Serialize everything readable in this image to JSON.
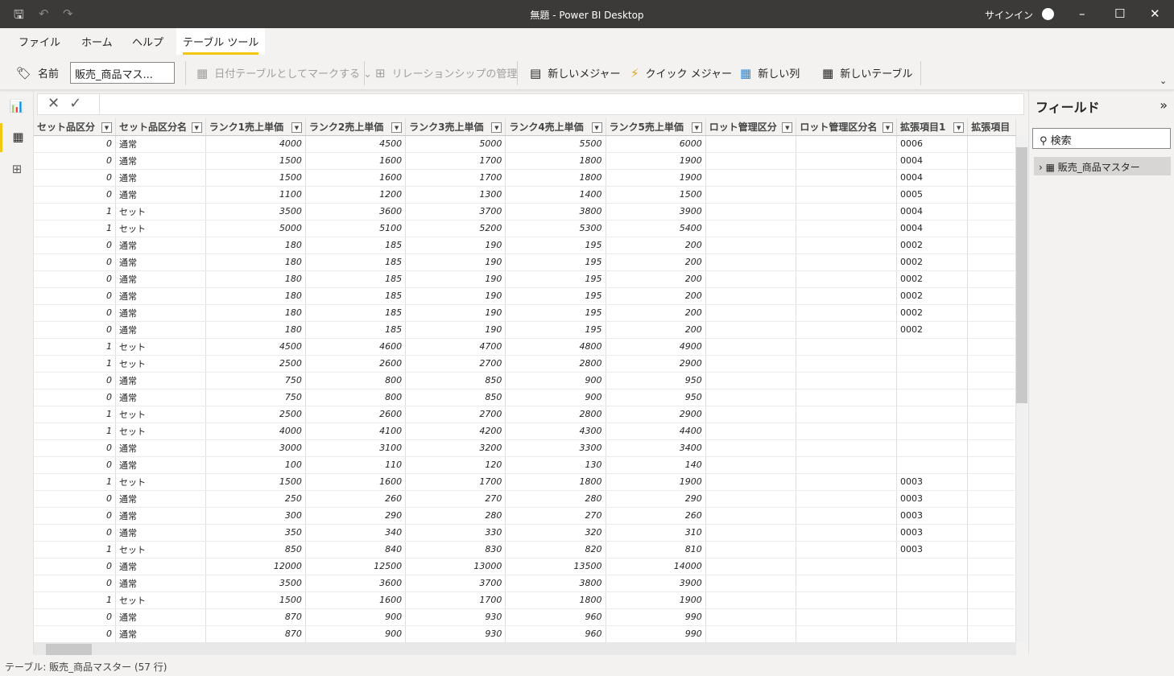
{
  "window": {
    "title": "無題 - Power BI Desktop",
    "signin": "サインイン"
  },
  "menu": {
    "items": [
      "ファイル",
      "ホーム",
      "ヘルプ",
      "テーブル ツール"
    ],
    "active": "テーブル ツール"
  },
  "ribbon": {
    "name_label": "名前",
    "name_value": "販売_商品マス...",
    "mark_date": "日付テーブルとしてマークする",
    "relations": "リレーションシップの管理",
    "new_measure": "新しいメジャー",
    "quick_measure": "クイック メジャー",
    "new_column": "新しい列",
    "new_table": "新しいテーブル"
  },
  "columns": [
    "セット品区分",
    "セット品区分名",
    "ランク1売上単価",
    "ランク2売上単価",
    "ランク3売上単価",
    "ランク4売上単価",
    "ランク5売上単価",
    "ロット管理区分",
    "ロット管理区分名",
    "拡張項目1",
    "拡張項目"
  ],
  "rows": [
    [
      "0",
      "通常",
      "4000",
      "4500",
      "5000",
      "5500",
      "6000",
      "",
      "",
      "0006"
    ],
    [
      "0",
      "通常",
      "1500",
      "1600",
      "1700",
      "1800",
      "1900",
      "",
      "",
      "0004"
    ],
    [
      "0",
      "通常",
      "1500",
      "1600",
      "1700",
      "1800",
      "1900",
      "",
      "",
      "0004"
    ],
    [
      "0",
      "通常",
      "1100",
      "1200",
      "1300",
      "1400",
      "1500",
      "",
      "",
      "0005"
    ],
    [
      "1",
      "セット",
      "3500",
      "3600",
      "3700",
      "3800",
      "3900",
      "",
      "",
      "0004"
    ],
    [
      "1",
      "セット",
      "5000",
      "5100",
      "5200",
      "5300",
      "5400",
      "",
      "",
      "0004"
    ],
    [
      "0",
      "通常",
      "180",
      "185",
      "190",
      "195",
      "200",
      "",
      "",
      "0002"
    ],
    [
      "0",
      "通常",
      "180",
      "185",
      "190",
      "195",
      "200",
      "",
      "",
      "0002"
    ],
    [
      "0",
      "通常",
      "180",
      "185",
      "190",
      "195",
      "200",
      "",
      "",
      "0002"
    ],
    [
      "0",
      "通常",
      "180",
      "185",
      "190",
      "195",
      "200",
      "",
      "",
      "0002"
    ],
    [
      "0",
      "通常",
      "180",
      "185",
      "190",
      "195",
      "200",
      "",
      "",
      "0002"
    ],
    [
      "0",
      "通常",
      "180",
      "185",
      "190",
      "195",
      "200",
      "",
      "",
      "0002"
    ],
    [
      "1",
      "セット",
      "4500",
      "4600",
      "4700",
      "4800",
      "4900",
      "",
      "",
      ""
    ],
    [
      "1",
      "セット",
      "2500",
      "2600",
      "2700",
      "2800",
      "2900",
      "",
      "",
      ""
    ],
    [
      "0",
      "通常",
      "750",
      "800",
      "850",
      "900",
      "950",
      "",
      "",
      ""
    ],
    [
      "0",
      "通常",
      "750",
      "800",
      "850",
      "900",
      "950",
      "",
      "",
      ""
    ],
    [
      "1",
      "セット",
      "2500",
      "2600",
      "2700",
      "2800",
      "2900",
      "",
      "",
      ""
    ],
    [
      "1",
      "セット",
      "4000",
      "4100",
      "4200",
      "4300",
      "4400",
      "",
      "",
      ""
    ],
    [
      "0",
      "通常",
      "3000",
      "3100",
      "3200",
      "3300",
      "3400",
      "",
      "",
      ""
    ],
    [
      "0",
      "通常",
      "100",
      "110",
      "120",
      "130",
      "140",
      "",
      "",
      ""
    ],
    [
      "1",
      "セット",
      "1500",
      "1600",
      "1700",
      "1800",
      "1900",
      "",
      "",
      "0003"
    ],
    [
      "0",
      "通常",
      "250",
      "260",
      "270",
      "280",
      "290",
      "",
      "",
      "0003"
    ],
    [
      "0",
      "通常",
      "300",
      "290",
      "280",
      "270",
      "260",
      "",
      "",
      "0003"
    ],
    [
      "0",
      "通常",
      "350",
      "340",
      "330",
      "320",
      "310",
      "",
      "",
      "0003"
    ],
    [
      "1",
      "セット",
      "850",
      "840",
      "830",
      "820",
      "810",
      "",
      "",
      "0003"
    ],
    [
      "0",
      "通常",
      "12000",
      "12500",
      "13000",
      "13500",
      "14000",
      "",
      "",
      ""
    ],
    [
      "0",
      "通常",
      "3500",
      "3600",
      "3700",
      "3800",
      "3900",
      "",
      "",
      ""
    ],
    [
      "1",
      "セット",
      "1500",
      "1600",
      "1700",
      "1800",
      "1900",
      "",
      "",
      ""
    ],
    [
      "0",
      "通常",
      "870",
      "900",
      "930",
      "960",
      "990",
      "",
      "",
      ""
    ],
    [
      "0",
      "通常",
      "870",
      "900",
      "930",
      "960",
      "990",
      "",
      "",
      ""
    ]
  ],
  "fields": {
    "title": "フィールド",
    "search_placeholder": "検索",
    "table": "販売_商品マスター"
  },
  "status": "テーブル: 販売_商品マスター (57 行)",
  "colors": {
    "accent": "#f2c811",
    "titlebar": "#3b3a39"
  }
}
